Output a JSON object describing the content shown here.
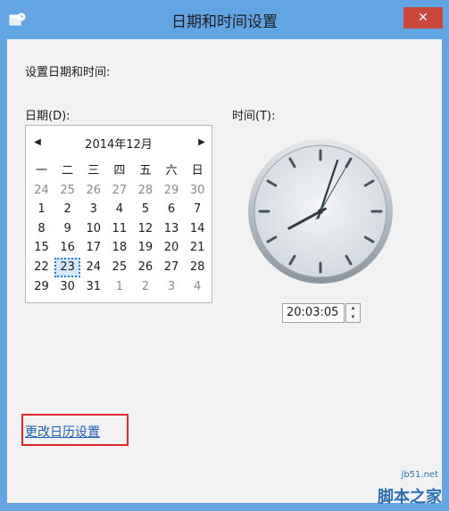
{
  "window": {
    "title": "日期和时间设置",
    "close_glyph": "✕"
  },
  "labels": {
    "heading": "设置日期和时间:",
    "date": "日期(D):",
    "time": "时间(T):"
  },
  "calendar": {
    "month_label": "2014年12月",
    "prev_glyph": "◀",
    "next_glyph": "▶",
    "weekdays": [
      "一",
      "二",
      "三",
      "四",
      "五",
      "六",
      "日"
    ],
    "weeks": [
      [
        {
          "d": "24",
          "o": true
        },
        {
          "d": "25",
          "o": true
        },
        {
          "d": "26",
          "o": true
        },
        {
          "d": "27",
          "o": true
        },
        {
          "d": "28",
          "o": true
        },
        {
          "d": "29",
          "o": true
        },
        {
          "d": "30",
          "o": true
        }
      ],
      [
        {
          "d": "1"
        },
        {
          "d": "2"
        },
        {
          "d": "3"
        },
        {
          "d": "4"
        },
        {
          "d": "5"
        },
        {
          "d": "6"
        },
        {
          "d": "7"
        }
      ],
      [
        {
          "d": "8"
        },
        {
          "d": "9"
        },
        {
          "d": "10"
        },
        {
          "d": "11"
        },
        {
          "d": "12"
        },
        {
          "d": "13"
        },
        {
          "d": "14"
        }
      ],
      [
        {
          "d": "15"
        },
        {
          "d": "16"
        },
        {
          "d": "17"
        },
        {
          "d": "18"
        },
        {
          "d": "19"
        },
        {
          "d": "20"
        },
        {
          "d": "21"
        }
      ],
      [
        {
          "d": "22"
        },
        {
          "d": "23",
          "sel": true
        },
        {
          "d": "24"
        },
        {
          "d": "25"
        },
        {
          "d": "26"
        },
        {
          "d": "27"
        },
        {
          "d": "28"
        }
      ],
      [
        {
          "d": "29"
        },
        {
          "d": "30"
        },
        {
          "d": "31"
        },
        {
          "d": "1",
          "o": true
        },
        {
          "d": "2",
          "o": true
        },
        {
          "d": "3",
          "o": true
        },
        {
          "d": "4",
          "o": true
        }
      ]
    ],
    "selected_day": "23"
  },
  "clock": {
    "hour": 20,
    "minute": 3,
    "second": 5
  },
  "time_field": {
    "value": "20:03:05",
    "up_glyph": "▲",
    "down_glyph": "▼"
  },
  "links": {
    "change_calendar": "更改日历设置"
  },
  "watermark": {
    "url": "jb51.net",
    "name": "脚本之家"
  },
  "colors": {
    "titlebar": "#63a4e3",
    "close": "#c9463c",
    "highlight": "#e0262b",
    "link": "#1a5fb4"
  }
}
